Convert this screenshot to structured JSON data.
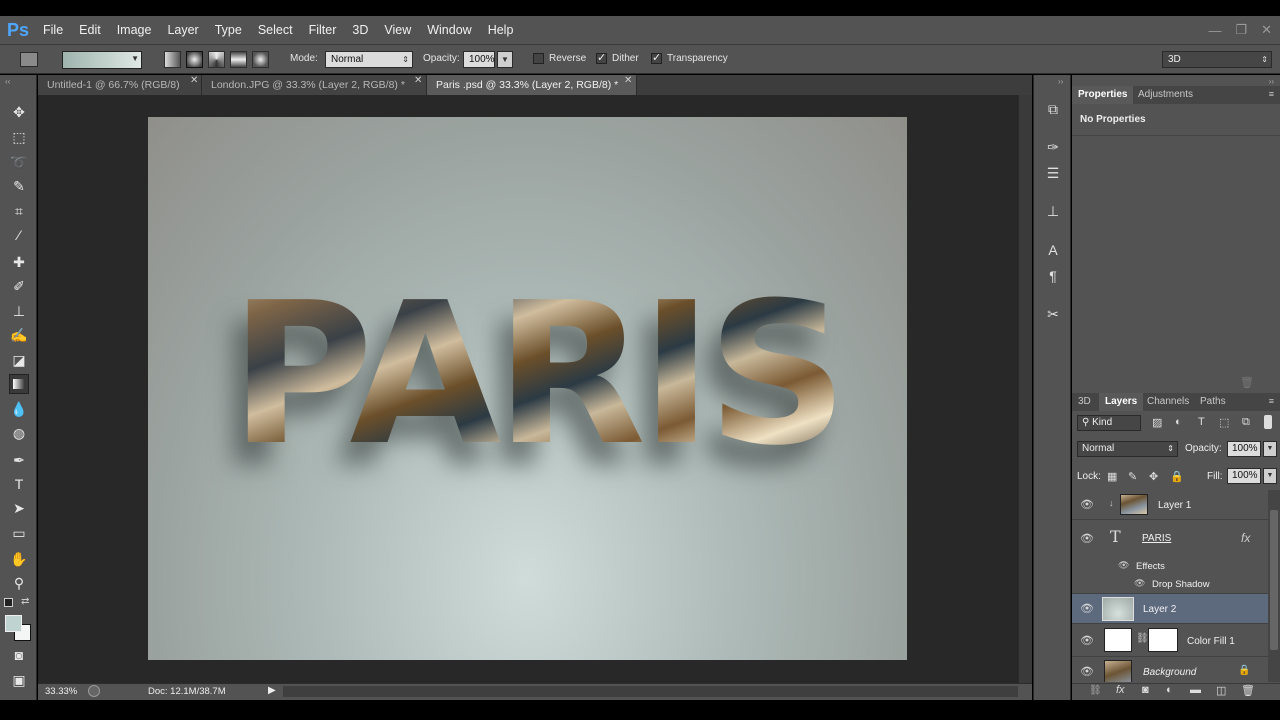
{
  "app": {
    "logo": "Ps"
  },
  "menu": [
    "File",
    "Edit",
    "Image",
    "Layer",
    "Type",
    "Select",
    "Filter",
    "3D",
    "View",
    "Window",
    "Help"
  ],
  "window_controls": [
    "—",
    "❐",
    "✕"
  ],
  "options": {
    "mode_label": "Mode:",
    "mode_value": "Normal",
    "opacity_label": "Opacity:",
    "opacity_value": "100%",
    "reverse_label": "Reverse",
    "dither_label": "Dither",
    "transparency_label": "Transparency",
    "reverse_checked": false,
    "dither_checked": true,
    "transparency_checked": true,
    "workspace_value": "3D",
    "gradient_colors": [
      "#9fb4ae",
      "#dfe8e4"
    ]
  },
  "tabs": [
    {
      "label": "Untitled-1 @ 66.7% (RGB/8)",
      "active": false
    },
    {
      "label": "London.JPG @ 33.3% (Layer 2, RGB/8) *",
      "active": false
    },
    {
      "label": "Paris .psd @ 33.3% (Layer 2, RGB/8) *",
      "active": true
    }
  ],
  "canvas": {
    "text": "PARIS"
  },
  "status": {
    "zoom": "33.33%",
    "doc": "Doc: 12.1M/38.7M"
  },
  "properties": {
    "tab_properties": "Properties",
    "tab_adjustments": "Adjustments",
    "content": "No Properties"
  },
  "layers_panel": {
    "tabs": [
      "3D",
      "Layers",
      "Channels",
      "Paths"
    ],
    "active_tab": "Layers",
    "filter_kind": "Kind",
    "blend_mode": "Normal",
    "opacity_label": "Opacity:",
    "opacity_value": "100%",
    "lock_label": "Lock:",
    "fill_label": "Fill:",
    "fill_value": "100%",
    "layers": {
      "layer1": "Layer 1",
      "paris": "PARIS",
      "effects": "Effects",
      "drop_shadow": "Drop Shadow",
      "layer2": "Layer 2",
      "color_fill": "Color Fill 1",
      "background": "Background"
    },
    "fx_label": "fx"
  },
  "colors": {
    "ui_bg": "#535353",
    "workspace_bg": "#282828",
    "selected_layer": "#5d6a7e",
    "ps_blue": "#4ea6ff"
  }
}
